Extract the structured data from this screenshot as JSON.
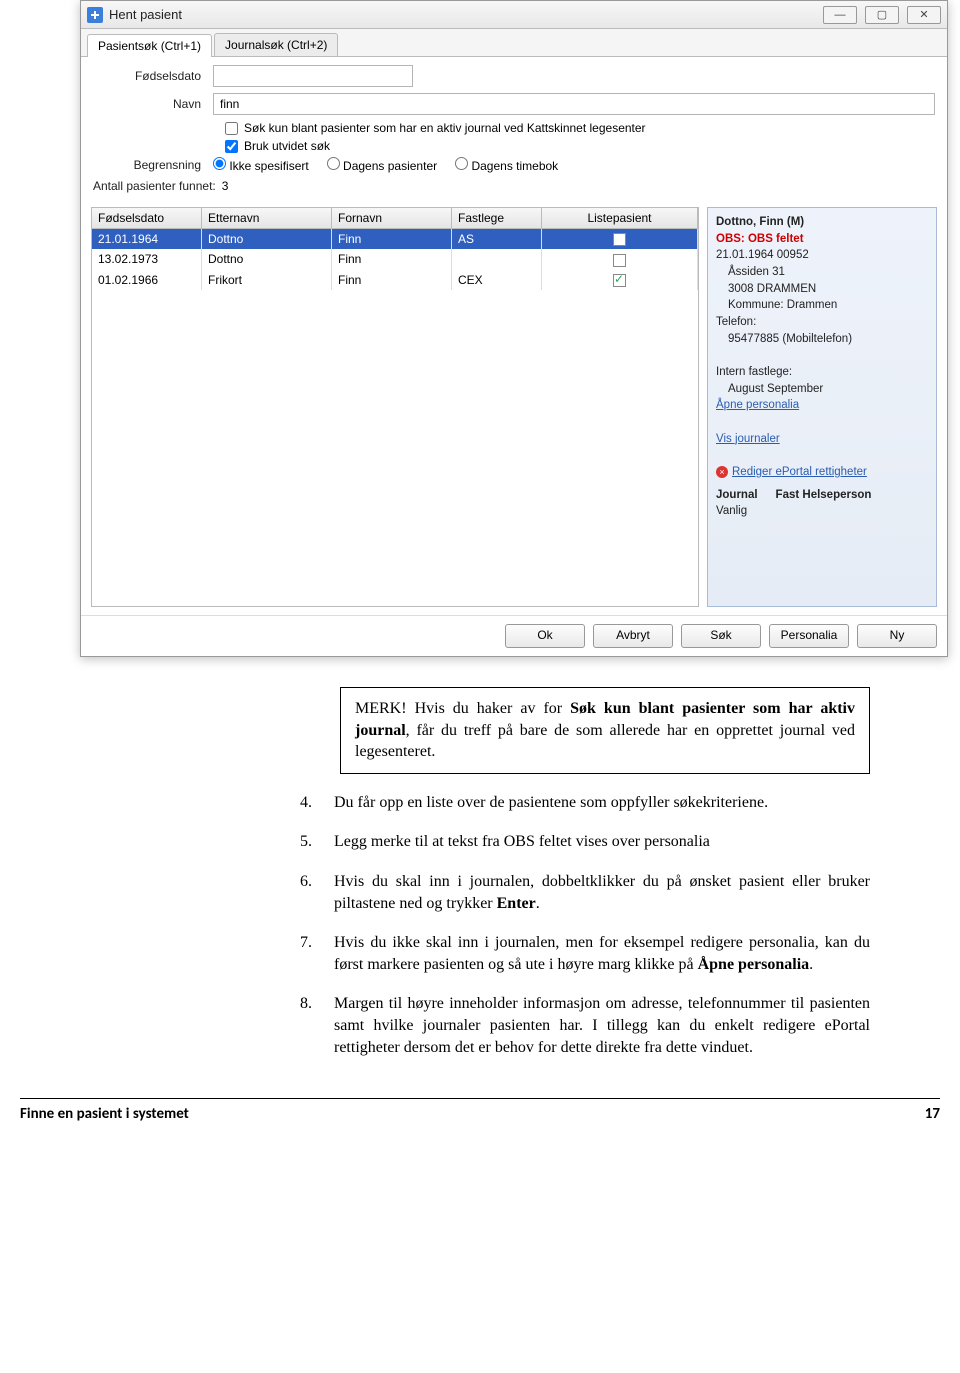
{
  "window": {
    "title": "Hent pasient",
    "btn_minimize": "—",
    "btn_maximize": "▢",
    "btn_close": "✕"
  },
  "tabs": {
    "t0": "Pasientsøk (Ctrl+1)",
    "t1": "Journalsøk (Ctrl+2)"
  },
  "form": {
    "label_dob": "Fødselsdato",
    "dob_value": "",
    "label_name": "Navn",
    "name_value": "finn",
    "chk_active_label": "Søk kun blant pasienter som har en aktiv journal ved Kattskinnet legesenter",
    "chk_active_checked": false,
    "chk_extended_label": "Bruk utvidet søk",
    "chk_extended_checked": true,
    "label_limit": "Begrensning",
    "r1": "Ikke spesifisert",
    "r2": "Dagens pasienter",
    "r3": "Dagens timebok",
    "label_count": "Antall pasienter funnet:",
    "count_value": "3"
  },
  "table": {
    "h1": "Fødselsdato",
    "h2": "Etternavn",
    "h3": "Fornavn",
    "h4": "Fastlege",
    "h5": "Listepasient",
    "rows": [
      {
        "c1": "21.01.1964",
        "c2": "Dottno",
        "c3": "Finn",
        "c4": "AS",
        "c5": false,
        "sel": true
      },
      {
        "c1": "13.02.1973",
        "c2": "Dottno",
        "c3": "Finn",
        "c4": "",
        "c5": false,
        "sel": false
      },
      {
        "c1": "01.02.1966",
        "c2": "Frikort",
        "c3": "Finn",
        "c4": "CEX",
        "c5": true,
        "sel": false
      }
    ]
  },
  "detail": {
    "name": "Dottno, Finn (M)",
    "obs": "OBS: OBS feltet",
    "dob_id": "21.01.1964 00952",
    "addr1": "Åssiden 31",
    "addr2": "3008 DRAMMEN",
    "kommune": "Kommune: Drammen",
    "tel_label": "Telefon:",
    "tel_val": "95477885 (Mobiltelefon)",
    "internfl_label": "Intern fastlege:",
    "internfl_val": "August September",
    "link_personalia": "Åpne personalia",
    "link_journaler": "Vis journaler",
    "link_eportal": "Rediger ePortal rettigheter",
    "col_journal": "Journal",
    "col_fhp": "Fast Helseperson",
    "journal_val": "Vanlig"
  },
  "buttons": {
    "ok": "Ok",
    "cancel": "Avbryt",
    "search": "Søk",
    "personalia": "Personalia",
    "new": "Ny"
  },
  "doc": {
    "merk_pre": "MERK! Hvis du haker av for ",
    "merk_bold1": "Søk kun blant pasienter som har aktiv journal",
    "merk_post": ", får du treff på bare de som allerede har en opprettet journal ved legesenteret.",
    "s4_n": "4.",
    "s4": "Du får opp en liste over de pasientene som oppfyller søkekriteriene.",
    "s5_n": "5.",
    "s5": "Legg merke til at tekst fra OBS feltet vises over personalia",
    "s6_n": "6.",
    "s6_a": "Hvis du skal inn i journalen, dobbeltklikker du på ønsket pasient eller bruker piltastene ned og trykker ",
    "s6_bold": "Enter",
    "s6_b": ".",
    "s7_n": "7.",
    "s7_a": "Hvis du ikke skal inn i journalen, men for eksempel redigere personalia, kan du først markere pasienten og så ute i høyre marg klikke på ",
    "s7_bold": "Åpne personalia",
    "s7_b": ".",
    "s8_n": "8.",
    "s8": "Margen til høyre inneholder informasjon om adresse, telefonnummer til pasienten samt hvilke journaler pasienten har. I tillegg kan du enkelt redigere ePortal rettigheter dersom det er behov for dette direkte fra dette vinduet.",
    "footer_left": "Finne en pasient i systemet",
    "footer_right": "17"
  }
}
